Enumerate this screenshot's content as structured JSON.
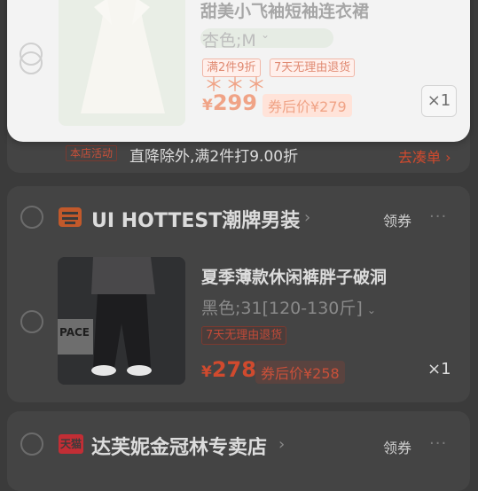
{
  "colors": {
    "background": "#3b3b3b",
    "card": "#444444",
    "price": "#d04a2e",
    "panel": "#f3f3f3"
  },
  "floating_item": {
    "title": "甜美小飞袖短袖连衣裙",
    "sku": "杏色;M",
    "tags": [
      "满2件9折",
      "7天无理由退货"
    ],
    "stars": "＊＊＊",
    "price": "299",
    "after_price": "券后价¥279",
    "qty": "×1"
  },
  "promo": {
    "badge": "本店活动",
    "text": "直降除外,满2件打9.00折",
    "link": "去凑单",
    "link_icon": "chevron-right-icon"
  },
  "shops": [
    {
      "name": "UI HOTTEST潮牌男装",
      "icon": "shop-icon",
      "coupon": "领券",
      "more": "···",
      "item": {
        "title": "夏季薄款休闲裤胖子破洞",
        "sku": "黑色;31[120-130斤]",
        "tags": [
          "7天无理由退货"
        ],
        "price": "278",
        "after_price": "券后价¥258",
        "qty": "×1",
        "image_text": "PACE"
      }
    },
    {
      "name": "达芙妮金冠林专卖店",
      "icon": "tmall-icon",
      "badge_text": "天猫",
      "coupon": "领券",
      "more": "···"
    }
  ],
  "currency": "¥"
}
